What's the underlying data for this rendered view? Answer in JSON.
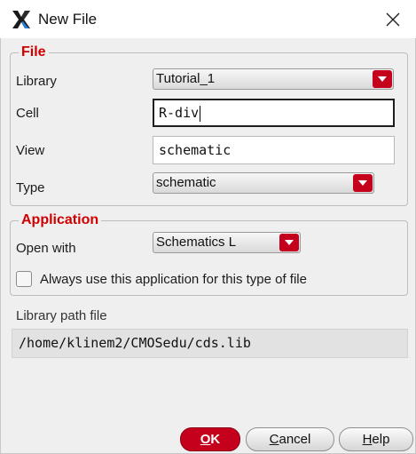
{
  "window": {
    "title": "New File",
    "app_icon": "cadence-x-logo",
    "close_icon": "close-icon"
  },
  "file_group": {
    "legend": "File",
    "library": {
      "label": "Library",
      "value": "Tutorial_1"
    },
    "cell": {
      "label": "Cell",
      "value": "R-div"
    },
    "view": {
      "label": "View",
      "value": "schematic"
    },
    "type": {
      "label": "Type",
      "value": "schematic"
    }
  },
  "application_group": {
    "legend": "Application",
    "open_with": {
      "label": "Open with",
      "value": "Schematics L"
    },
    "always_use": {
      "label": "Always use this application for this type of file",
      "checked": false
    }
  },
  "library_path": {
    "label": "Library path file",
    "value": "/home/klinem2/CMOSedu/cds.lib"
  },
  "buttons": {
    "ok": {
      "label": "OK",
      "key": "O",
      "rest": "K"
    },
    "cancel": {
      "label": "Cancel",
      "key": "C",
      "rest": "ancel"
    },
    "help": {
      "label": "Help",
      "key": "H",
      "rest": "elp"
    }
  },
  "colors": {
    "accent": "#c4001c",
    "legend": "#d00000",
    "dialog_bg": "#efefef"
  }
}
